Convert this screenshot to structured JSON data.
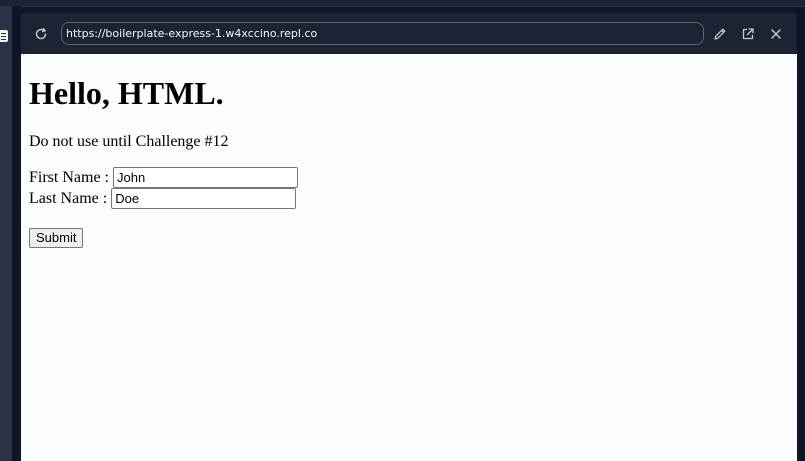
{
  "browser": {
    "url": "https://boilerplate-express-1.w4xccino.repl.co",
    "icons": {
      "reload": "reload-icon",
      "edit": "pencil-icon",
      "open_new": "external-link-icon",
      "close": "close-icon"
    },
    "colors": {
      "chrome": "#1c2333",
      "background": "#0e1525",
      "text": "#f5f9fc"
    }
  },
  "page": {
    "title": "Hello, HTML.",
    "paragraph": "Do not use until Challenge #12",
    "form": {
      "first_label": "First Name :",
      "first_value": "John",
      "last_label": "Last Name :",
      "last_value": "Doe",
      "submit_label": "Submit"
    }
  }
}
